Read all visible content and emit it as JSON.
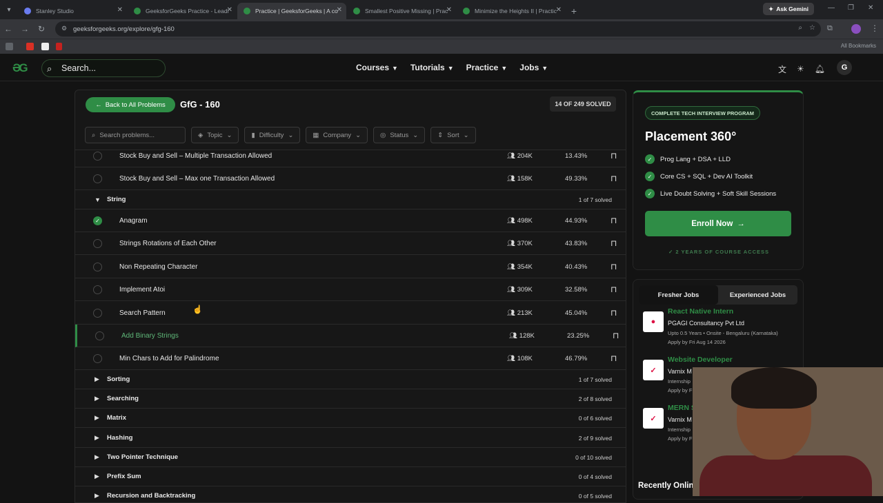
{
  "browser": {
    "tabs": [
      {
        "title": "Stanley Studio",
        "favicon": "studio"
      },
      {
        "title": "GeeksforGeeks Practice - Leadi",
        "favicon": "gfg"
      },
      {
        "title": "Practice | GeeksforGeeks | A co",
        "favicon": "gfg"
      },
      {
        "title": "Smallest Positive Missing | Prac",
        "favicon": "gfg"
      },
      {
        "title": "Minimize the Heights II | Practic",
        "favicon": "gfg"
      }
    ],
    "ask_gemini": "Ask Gemini",
    "url": "geeksforgeeks.org/explore/gfg-160",
    "all_bookmarks": "All Bookmarks"
  },
  "site_nav": {
    "search_placeholder": "Search...",
    "menu": [
      "Courses",
      "Tutorials",
      "Practice",
      "Jobs"
    ],
    "avatar": "G"
  },
  "panel": {
    "back_button": "Back to All Problems",
    "title": "GfG - 160",
    "solved_badge": "14 OF 249 SOLVED",
    "search_placeholder": "Search problems...",
    "filters": [
      "Topic",
      "Difficulty",
      "Company",
      "Status",
      "Sort"
    ]
  },
  "problems_top": [
    {
      "name": "Stock Buy and Sell – Multiple Transaction Allowed",
      "subs": "204K",
      "pct": "13.43%"
    },
    {
      "name": "Stock Buy and Sell – Max one Transaction Allowed",
      "subs": "158K",
      "pct": "49.33%"
    }
  ],
  "string_section": {
    "name": "String",
    "count": "1 of 7 solved"
  },
  "string_problems": [
    {
      "name": "Anagram",
      "subs": "498K",
      "pct": "44.93%",
      "solved": true
    },
    {
      "name": "Strings Rotations of Each Other",
      "subs": "370K",
      "pct": "43.83%",
      "solved": false
    },
    {
      "name": "Non Repeating Character",
      "subs": "354K",
      "pct": "40.43%",
      "solved": false
    },
    {
      "name": "Implement Atoi",
      "subs": "309K",
      "pct": "32.58%",
      "solved": false
    },
    {
      "name": "Search Pattern",
      "subs": "213K",
      "pct": "45.04%",
      "solved": false
    },
    {
      "name": "Add Binary Strings",
      "subs": "128K",
      "pct": "23.25%",
      "solved": false,
      "highlight": true
    },
    {
      "name": "Min Chars to Add for Palindrome",
      "subs": "108K",
      "pct": "46.79%",
      "solved": false
    }
  ],
  "sections": [
    {
      "name": "Sorting",
      "count": "1 of 7 solved"
    },
    {
      "name": "Searching",
      "count": "2 of 8 solved"
    },
    {
      "name": "Matrix",
      "count": "0 of 6 solved"
    },
    {
      "name": "Hashing",
      "count": "2 of 9 solved"
    },
    {
      "name": "Two Pointer Technique",
      "count": "0 of 10 solved"
    },
    {
      "name": "Prefix Sum",
      "count": "0 of 4 solved"
    },
    {
      "name": "Recursion and Backtracking",
      "count": "0 of 5 solved"
    }
  ],
  "promo": {
    "tag": "COMPLETE TECH INTERVIEW PROGRAM",
    "title": "Placement 360°",
    "features": [
      "Prog Lang + DSA + LLD",
      "Core CS + SQL + Dev AI Toolkit",
      "Live Doubt Solving + Soft Skill Sessions"
    ],
    "button": "Enroll Now",
    "access": "2 YEARS OF COURSE ACCESS"
  },
  "jobs": {
    "tabs": [
      "Fresher Jobs",
      "Experienced Jobs"
    ],
    "items": [
      {
        "title": "React Native Intern",
        "company": "PGAGI Consultancy Pvt Ltd",
        "meta": "Upto 0.5 Years • Onsite - Bengaluru (Karnataka)",
        "apply": "Apply by Fri Aug 14 2026"
      },
      {
        "title": "Website Developer",
        "company": "Varnix M",
        "meta": "Internship",
        "apply": "Apply by F"
      },
      {
        "title": "MERN S",
        "company": "Varnix M",
        "meta": "Internship",
        "apply": "Apply by F"
      }
    ],
    "recent": "Recently Onlin"
  },
  "colors": {
    "accent": "#2f8d46",
    "background": "#131313"
  }
}
